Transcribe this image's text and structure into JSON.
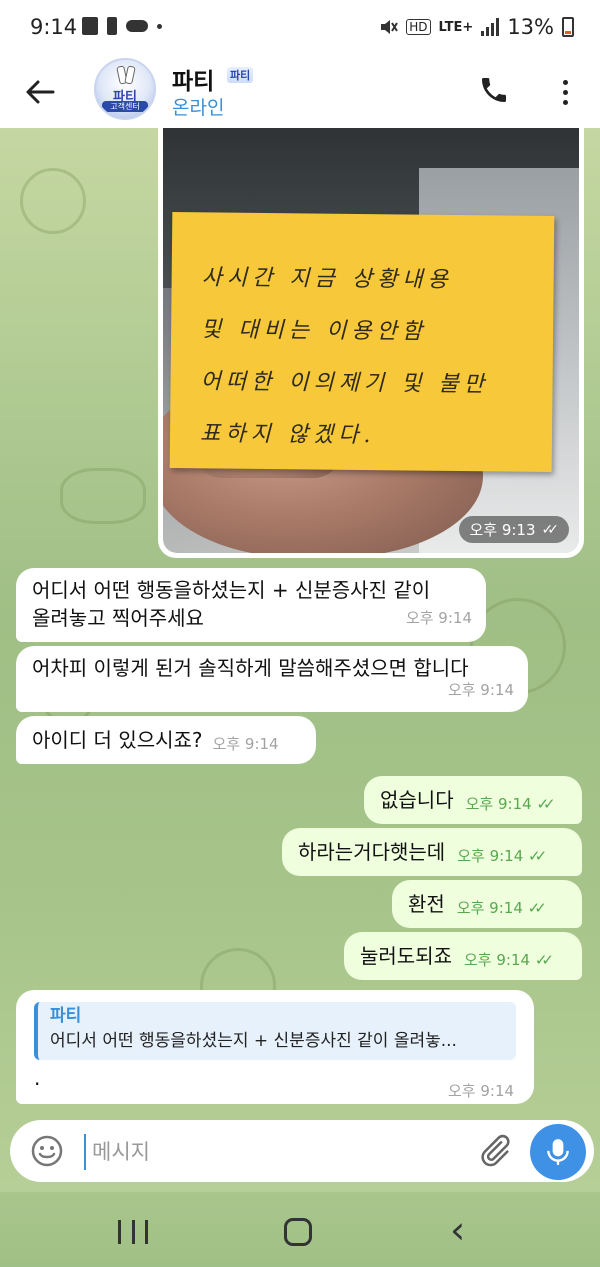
{
  "status_bar": {
    "time": "9:14",
    "network_badge": "HD",
    "network_type": "LTE+",
    "battery_percent": "13%"
  },
  "header": {
    "contact_name": "파티",
    "contact_badge": "파티",
    "contact_status": "온라인",
    "avatar_text": "파티",
    "avatar_subtext": "고객센터"
  },
  "photo_message": {
    "note_lines": [
      "사시간 지금 상황내용",
      "및 대비는 이용안함",
      "어떠한 이의제기 및 불만",
      "표하지 않겠다."
    ],
    "time": "오후 9:13"
  },
  "messages": [
    {
      "direction": "in",
      "text_line1": "어디서 어떤 행동을하셨는지 + 신분증사진 같이",
      "text_line2": "올려놓고 찍어주세요",
      "time": "오후 9:14"
    },
    {
      "direction": "in",
      "text": "어차피 이렇게 된거 솔직하게 말씀해주셨으면 합니다",
      "time": "오후 9:14"
    },
    {
      "direction": "in",
      "text": "아이디 더 있으시죠?",
      "time": "오후 9:14"
    },
    {
      "direction": "out",
      "text": "없습니다",
      "time": "오후 9:14"
    },
    {
      "direction": "out",
      "text": "하라는거다햇는데",
      "time": "오후 9:14"
    },
    {
      "direction": "out",
      "text": "환전",
      "time": "오후 9:14"
    },
    {
      "direction": "out",
      "text": "눌러도되죠",
      "time": "오후 9:14"
    }
  ],
  "reply_message": {
    "quote_name": "파티",
    "quote_text": "어디서 어떤 행동을하셨는지 + 신분증사진 같이 올려놓...",
    "text": ".",
    "time": "오후 9:14"
  },
  "input": {
    "placeholder": "메시지"
  },
  "icons": {
    "back": "arrow-left-icon",
    "call": "phone-icon",
    "menu": "more-vertical-icon",
    "emoji": "smiley-icon",
    "attach": "paperclip-icon",
    "mic": "microphone-icon"
  },
  "colors": {
    "accent": "#3a8fd6",
    "outgoing_bubble": "#effedd",
    "read_ticks": "#5aa751",
    "sticky_note": "#f6c83a"
  }
}
